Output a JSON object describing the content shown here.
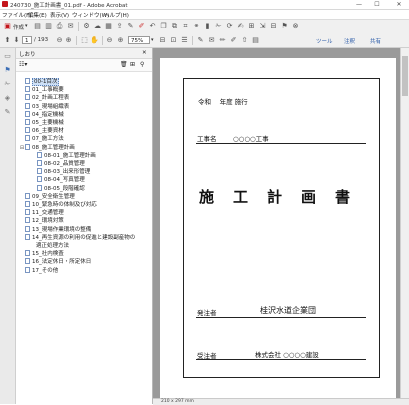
{
  "window": {
    "title": "240730_施工計画書_01.pdf - Adobe Acrobat",
    "controls": [
      "—",
      "☐",
      "✕"
    ]
  },
  "menu": [
    "ファイル(F)",
    "編集(E)",
    "表示(V)",
    "ウィンドウ(W)",
    "ヘルプ(H)"
  ],
  "toolbar": {
    "create_label": "作成",
    "page_current": "1",
    "page_total": "/ 193",
    "zoom_value": "75%",
    "right_links": [
      "ツール",
      "注釈",
      "共有"
    ]
  },
  "bookmarks_panel": {
    "header": "しおり",
    "items": [
      {
        "label": "00-1目次",
        "level": 0,
        "selected": true
      },
      {
        "label": "01_工事概要",
        "level": 0
      },
      {
        "label": "02_計画工程表",
        "level": 0
      },
      {
        "label": "03_現場組織表",
        "level": 0
      },
      {
        "label": "04_指定機械",
        "level": 0
      },
      {
        "label": "05_主要機械",
        "level": 0
      },
      {
        "label": "06_主要資材",
        "level": 0
      },
      {
        "label": "07_施工方法",
        "level": 0
      },
      {
        "label": "08_施工管理計画",
        "level": 0,
        "expanded": true
      },
      {
        "label": "08-01_施工管理計画",
        "level": 1
      },
      {
        "label": "08-02_品質管理",
        "level": 1
      },
      {
        "label": "08-03_出来形管理",
        "level": 1
      },
      {
        "label": "08-04_写真管理",
        "level": 1
      },
      {
        "label": "08-05_段階確認",
        "level": 1
      },
      {
        "label": "09_安全衛生管理",
        "level": 0
      },
      {
        "label": "10_緊急時の体制及び対応",
        "level": 0
      },
      {
        "label": "11_交通管理",
        "level": 0
      },
      {
        "label": "12_環境対策",
        "level": 0
      },
      {
        "label": "13_現場作業環境の整備",
        "level": 0
      },
      {
        "label": "14_再生資源の利用の促進と建設副産物の",
        "label2": "適正処理方法",
        "level": 0
      },
      {
        "label": "15_社内検査",
        "level": 0
      },
      {
        "label": "16_法定休日・所定休日",
        "level": 0
      },
      {
        "label": "17_その他",
        "level": 0
      }
    ]
  },
  "document": {
    "era_line": "令和　 年度 施行",
    "project_label": "工事名",
    "project_name": "○○○○工事",
    "main_title": "施　工　計　画　書",
    "client_label": "発注者",
    "client_name": "桂沢水道企業団",
    "contractor_label": "受注者",
    "contractor_name": "株式会社 ○○○○建設"
  },
  "status": {
    "page_size": "210 x 297 mm"
  }
}
